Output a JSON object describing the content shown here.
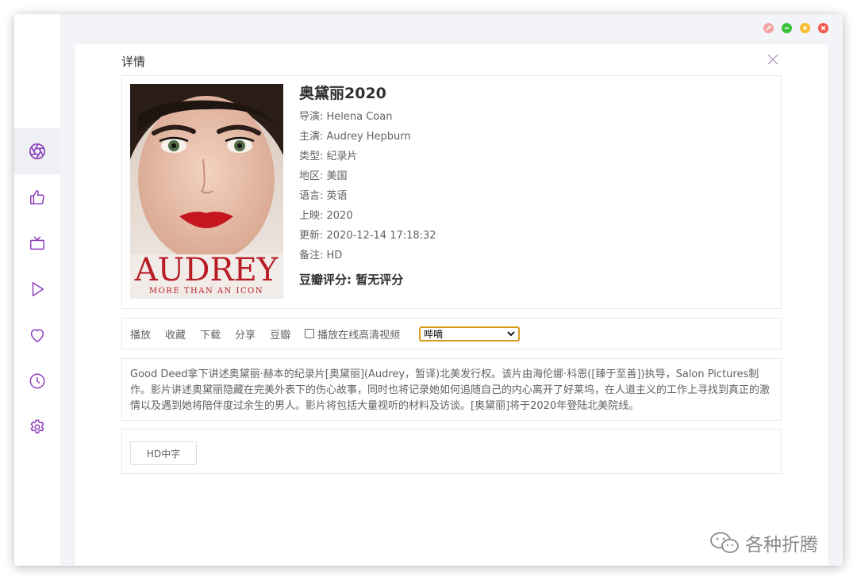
{
  "dialog": {
    "title": "详情"
  },
  "movie": {
    "title": "奥黛丽2020",
    "info": [
      "导演: Helena Coan",
      "主演: Audrey Hepburn",
      "类型: 纪录片",
      "地区: 美国",
      "语言: 英语",
      "上映: 2020",
      "更新: 2020-12-14 17:18:32",
      "备注: HD"
    ],
    "rating": "豆瓣评分: 暂无评分",
    "poster": {
      "title": "AUDREY",
      "subtitle": "MORE THAN AN ICON"
    }
  },
  "actions": {
    "play": "播放",
    "favorite": "收藏",
    "download": "下载",
    "share": "分享",
    "douban": "豆瓣",
    "hd_checkbox_label": "播放在线高清视频",
    "player_select_value": "哔嘀"
  },
  "description": "Good Deed拿下讲述奥黛丽·赫本的纪录片[奥黛丽](Audrey，暂译)北美发行权。该片由海伦娜·科恩([臻于至善])执导，Salon Pictures制作。影片讲述奥黛丽隐藏在完美外表下的伤心故事，同时也将记录她如何追随自己的内心离开了好莱坞，在人道主义的工作上寻找到真正的激情以及遇到她将陪伴度过余生的男人。影片将包括大量视听的材料及访谈。[奥黛丽]将于2020年登陆北美院线。",
  "episodes": [
    "HD中字"
  ],
  "watermark": "各种折腾",
  "sidebar": {
    "items": [
      "aperture-icon",
      "thumbs-up-icon",
      "tv-icon",
      "play-icon",
      "heart-icon",
      "clock-icon",
      "settings-icon"
    ]
  },
  "colors": {
    "accent": "#8b3dbd",
    "close_red": "#f25a4e",
    "minimize_green": "#3cc13b",
    "maximize_yellow": "#f7bd2f"
  }
}
